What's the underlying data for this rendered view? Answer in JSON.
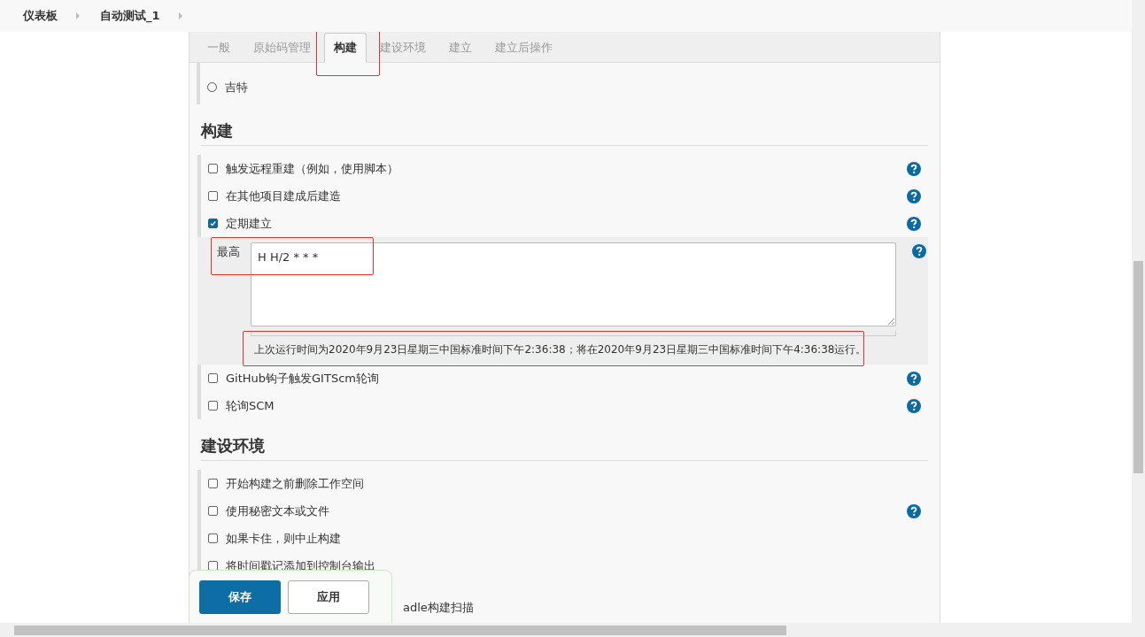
{
  "breadcrumbs": [
    "仪表板",
    "自动测试_1"
  ],
  "tabs": [
    {
      "label": "一般",
      "selected": false
    },
    {
      "label": "原始码管理",
      "selected": false
    },
    {
      "label": "构建",
      "selected": true
    },
    {
      "label": "建设环境",
      "selected": false
    },
    {
      "label": "建立",
      "selected": false
    },
    {
      "label": "建立后操作",
      "selected": false
    }
  ],
  "scm_options": [
    {
      "label": "吉特",
      "selected": false
    }
  ],
  "sections": [
    {
      "title": "构建",
      "items": [
        {
          "label": "触发远程重建（例如，使用脚本）",
          "checked": false,
          "help": true
        },
        {
          "label": "在其他项目建成后建造",
          "checked": false,
          "help": true
        },
        {
          "label": "定期建立",
          "checked": true,
          "help": true,
          "schedule": {
            "label": "最高",
            "value": "H H/2 * * *",
            "note": "上次运行时间为2020年9月23日星期三中国标准时间下午2:36:38；将在2020年9月23日星期三中国标准时间下午4:36:38运行。"
          }
        },
        {
          "label": "GitHub钩子触发GITScm轮询",
          "checked": false,
          "help": true
        },
        {
          "label": "轮询SCM",
          "checked": false,
          "help": true
        }
      ]
    },
    {
      "title": "建设环境",
      "items": [
        {
          "label": "开始构建之前删除工作空间",
          "checked": false,
          "help": false
        },
        {
          "label": "使用秘密文本或文件",
          "checked": false,
          "help": true
        },
        {
          "label": "如果卡住，则中止构建",
          "checked": false,
          "help": false
        },
        {
          "label": "将时间戳记添加到控制台输出",
          "checked": false,
          "help": false
        },
        {
          "label": "adle构建扫描",
          "kind": "covered",
          "help": false
        }
      ]
    }
  ],
  "buttons": [
    {
      "label": "保存",
      "kind": "primary"
    },
    {
      "label": "应用",
      "kind": "secondary"
    }
  ]
}
